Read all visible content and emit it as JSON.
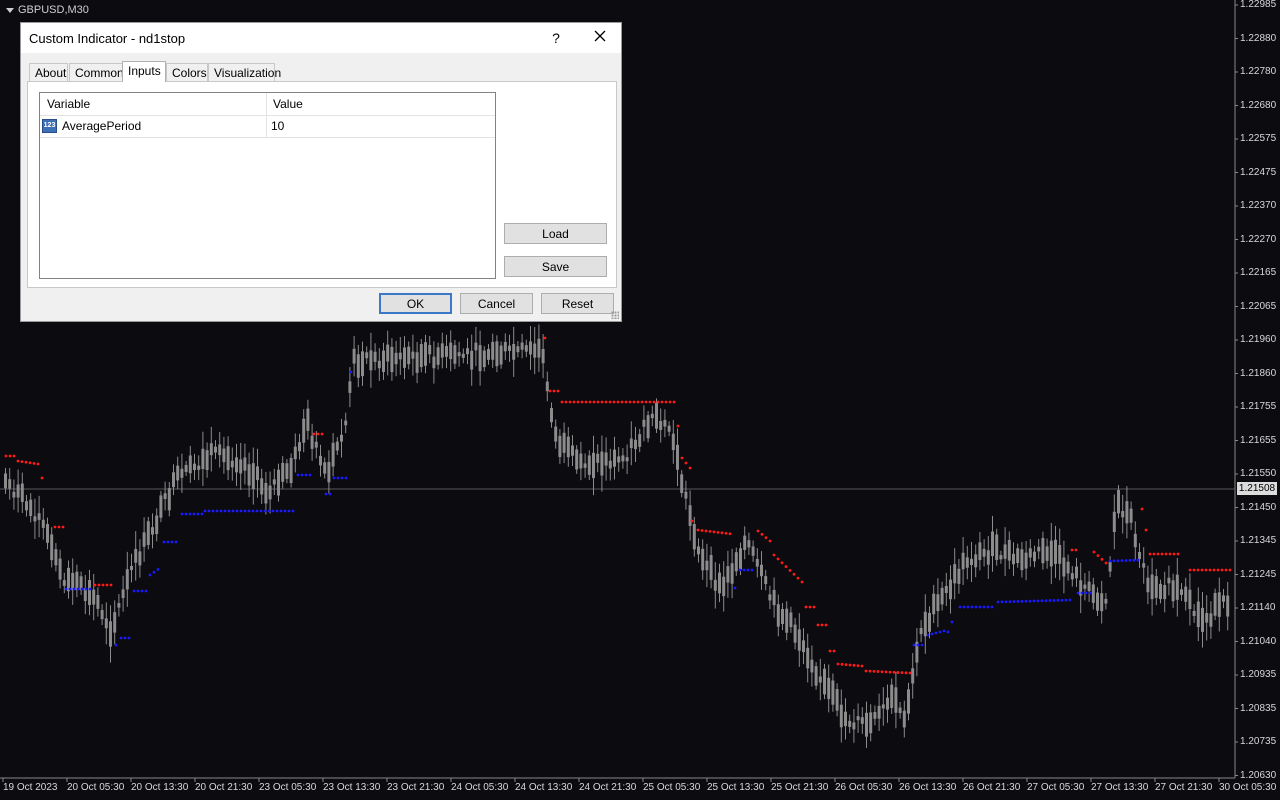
{
  "chart": {
    "title": "GBPUSD,M30",
    "price_scale": [
      "1.22985",
      "1.22880",
      "1.22780",
      "1.22680",
      "1.22575",
      "1.22475",
      "1.22370",
      "1.22270",
      "1.22165",
      "1.22065",
      "1.21960",
      "1.21860",
      "1.21755",
      "1.21655",
      "1.21550",
      "1.21450",
      "1.21345",
      "1.21245",
      "1.21140",
      "1.21040",
      "1.20935",
      "1.20835",
      "1.20735",
      "1.20630"
    ],
    "time_scale": [
      "19 Oct 2023",
      "20 Oct 05:30",
      "20 Oct 13:30",
      "20 Oct 21:30",
      "23 Oct 05:30",
      "23 Oct 13:30",
      "23 Oct 21:30",
      "24 Oct 05:30",
      "24 Oct 13:30",
      "24 Oct 21:30",
      "25 Oct 05:30",
      "25 Oct 13:30",
      "25 Oct 21:30",
      "26 Oct 05:30",
      "26 Oct 13:30",
      "26 Oct 21:30",
      "27 Oct 05:30",
      "27 Oct 13:30",
      "27 Oct 21:30",
      "30 Oct 05:30"
    ],
    "current_price": "1.21508",
    "colors": {
      "background": "#0b0b10",
      "candle": "#8c8c8c",
      "stop_up": "#1a1aff",
      "stop_down": "#ff1a1a",
      "price_line": "#5a5a5a"
    }
  },
  "dialog": {
    "title": "Custom Indicator - nd1stop",
    "help_label": "?",
    "close_icon": "close-icon",
    "tabs": [
      {
        "label": "About",
        "active": false
      },
      {
        "label": "Common",
        "active": false
      },
      {
        "label": "Inputs",
        "active": true
      },
      {
        "label": "Colors",
        "active": false
      },
      {
        "label": "Visualization",
        "active": false
      }
    ],
    "table": {
      "columns": [
        "Variable",
        "Value"
      ],
      "rows": [
        {
          "icon": "integer-param-icon",
          "icon_text": "123",
          "variable": "AveragePeriod",
          "value": "10"
        }
      ]
    },
    "load_label": "Load",
    "save_label": "Save",
    "ok_label": "OK",
    "cancel_label": "Cancel",
    "reset_label": "Reset"
  }
}
